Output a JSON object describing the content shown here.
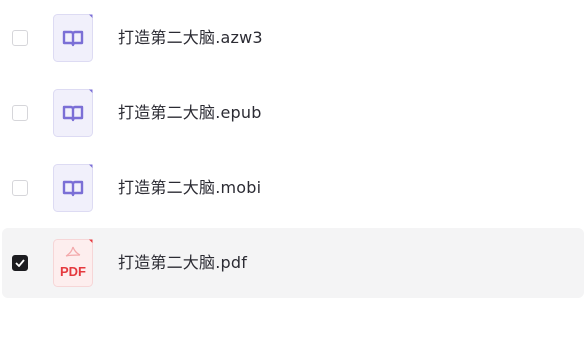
{
  "files": [
    {
      "name": "打造第二大脑.azw3",
      "type": "ebook",
      "icon": "book-icon",
      "selected": false
    },
    {
      "name": "打造第二大脑.epub",
      "type": "ebook",
      "icon": "book-icon",
      "selected": false
    },
    {
      "name": "打造第二大脑.mobi",
      "type": "ebook",
      "icon": "book-icon",
      "selected": false
    },
    {
      "name": "打造第二大脑.pdf",
      "type": "pdf",
      "icon": "pdf-icon",
      "icon_label": "PDF",
      "selected": true
    }
  ],
  "colors": {
    "ebook_icon_accent": "#7b6fd6",
    "ebook_icon_bg": "#f1f0fb",
    "pdf_icon_accent": "#e5393e",
    "pdf_icon_bg": "#fdeeee",
    "selected_row_bg": "#f4f4f5",
    "checkbox_checked": "#1c1c20"
  }
}
